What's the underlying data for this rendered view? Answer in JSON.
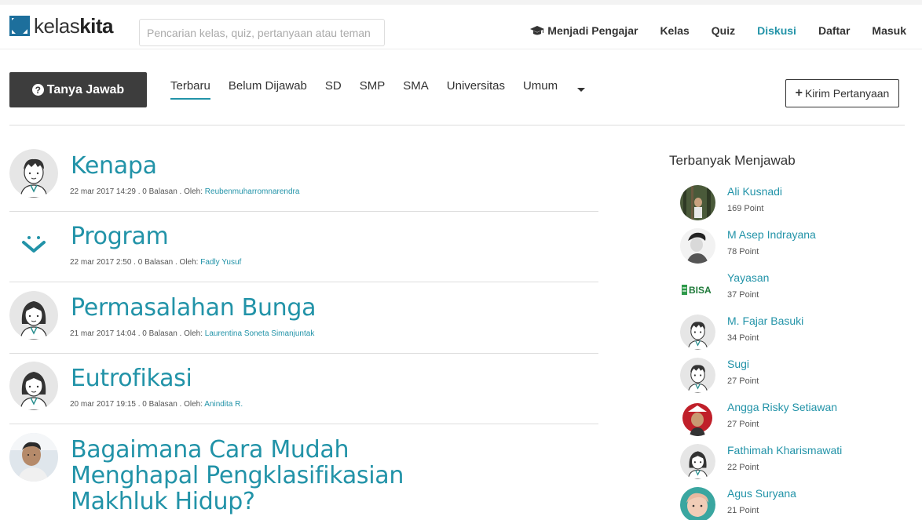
{
  "brand": {
    "light": "kelas",
    "bold": "kita"
  },
  "search": {
    "placeholder": "Pencarian kelas, quiz, pertanyaan atau teman"
  },
  "nav": {
    "items": [
      {
        "label": "Menjadi Pengajar",
        "icon": "graduation-cap-icon"
      },
      {
        "label": "Kelas"
      },
      {
        "label": "Quiz"
      },
      {
        "label": "Diskusi",
        "active": true
      },
      {
        "label": "Daftar"
      },
      {
        "label": "Masuk"
      }
    ]
  },
  "tanya_button": {
    "label": "Tanya Jawab",
    "icon": "question-circle-icon"
  },
  "tabs": [
    "Terbaru",
    "Belum Dijawab",
    "SD",
    "SMP",
    "SMA",
    "Universitas",
    "Umum"
  ],
  "kirim_button": {
    "label": "Kirim Pertanyaan",
    "icon": "plus-icon"
  },
  "questions": [
    {
      "title": "Kenapa",
      "meta": "22 mar 2017 14:29 . 0 Balasan . Oleh: ",
      "author": "Reubenmuharromnarendra",
      "avatar": "boy-avatar"
    },
    {
      "title": "Program",
      "meta": "22 mar 2017 2:50 . 0 Balasan . Oleh: ",
      "author": "Fadly Yusuf",
      "avatar": "smile-logo-avatar"
    },
    {
      "title": "Permasalahan Bunga",
      "meta": "21 mar 2017 14:04 . 0 Balasan . Oleh: ",
      "author": "Laurentina Soneta Simanjuntak",
      "avatar": "girl-avatar"
    },
    {
      "title": "Eutrofikasi",
      "meta": "20 mar 2017 19:15 . 0 Balasan . Oleh: ",
      "author": "Anindita R.",
      "avatar": "girl-avatar"
    },
    {
      "title_lines": [
        "Bagaimana Cara Mudah",
        "Menghapal Pengklasifikasian",
        "Makhluk Hidup?"
      ],
      "avatar": "photo-avatar"
    }
  ],
  "sidebar": {
    "title": "Terbanyak Menjawab",
    "users": [
      {
        "name": "Ali Kusnadi",
        "points": "169 Point",
        "avatar": "forest-photo-avatar"
      },
      {
        "name": "M Asep Indrayana",
        "points": "78 Point",
        "avatar": "sketch-photo-avatar"
      },
      {
        "name": "Yayasan",
        "points": "37 Point",
        "avatar": "bisa-logo-avatar",
        "logo_text": "BISA"
      },
      {
        "name": "M. Fajar Basuki",
        "points": "34 Point",
        "avatar": "boy-avatar"
      },
      {
        "name": "Sugi",
        "points": "27 Point",
        "avatar": "boy-avatar"
      },
      {
        "name": "Angga Risky Setiawan",
        "points": "27 Point",
        "avatar": "red-photo-avatar"
      },
      {
        "name": "Fathimah Kharismawati",
        "points": "22 Point",
        "avatar": "girl-avatar"
      },
      {
        "name": "Agus Suryana",
        "points": "21 Point",
        "avatar": "child-photo-avatar"
      }
    ]
  },
  "colors": {
    "accent": "#2293a8",
    "dark_button": "#3d3d3d",
    "logo_blue": "#1d6f9c"
  }
}
